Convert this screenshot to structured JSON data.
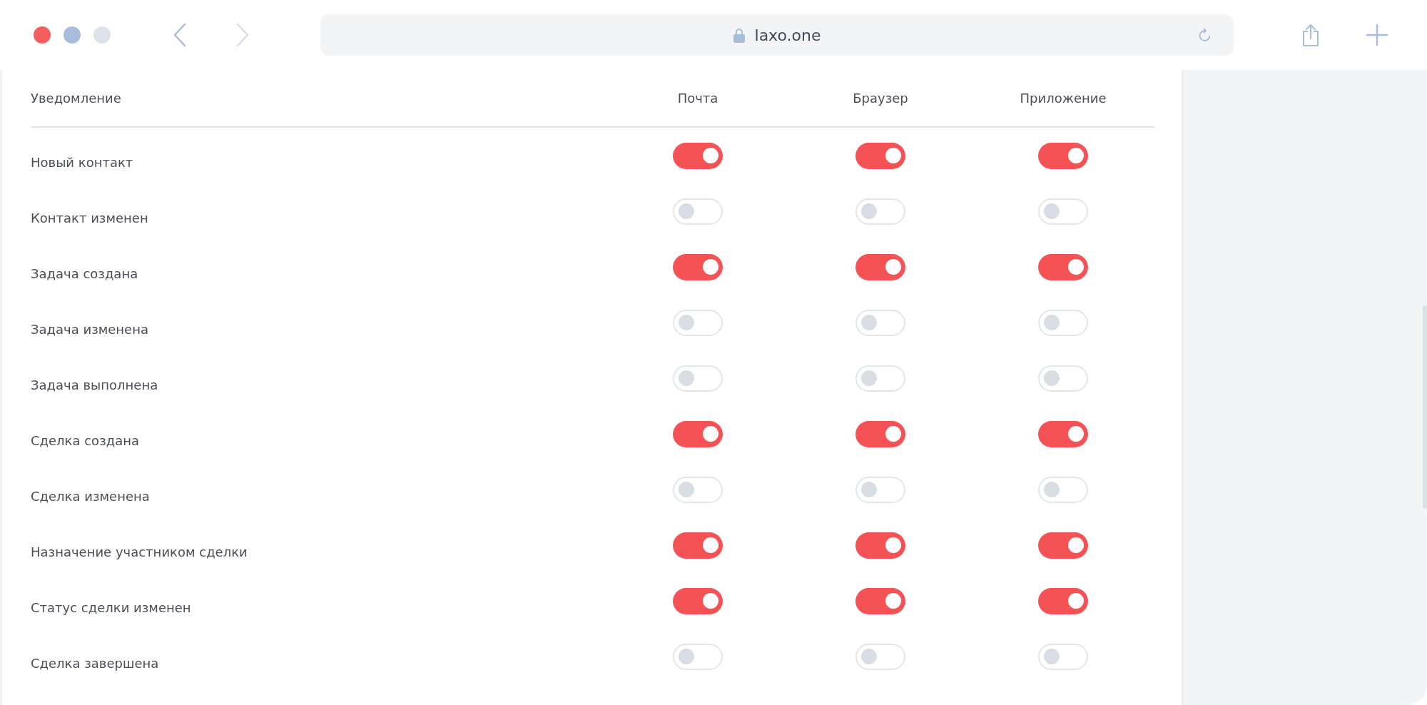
{
  "browser": {
    "url": "laxo.one"
  },
  "table": {
    "columns": [
      "Уведомление",
      "Почта",
      "Браузер",
      "Приложение"
    ],
    "rows": [
      {
        "label": "Новый контакт",
        "mail": true,
        "browser": true,
        "app": true
      },
      {
        "label": "Контакт изменен",
        "mail": false,
        "browser": false,
        "app": false
      },
      {
        "label": "Задача создана",
        "mail": true,
        "browser": true,
        "app": true
      },
      {
        "label": "Задача изменена",
        "mail": false,
        "browser": false,
        "app": false
      },
      {
        "label": "Задача выполнена",
        "mail": false,
        "browser": false,
        "app": false
      },
      {
        "label": "Сделка создана",
        "mail": true,
        "browser": true,
        "app": true
      },
      {
        "label": "Сделка изменена",
        "mail": false,
        "browser": false,
        "app": false
      },
      {
        "label": "Назначение участником сделки",
        "mail": true,
        "browser": true,
        "app": true
      },
      {
        "label": "Статус сделки изменен",
        "mail": true,
        "browser": true,
        "app": true
      },
      {
        "label": "Сделка завершена",
        "mail": false,
        "browser": false,
        "app": false
      }
    ]
  }
}
